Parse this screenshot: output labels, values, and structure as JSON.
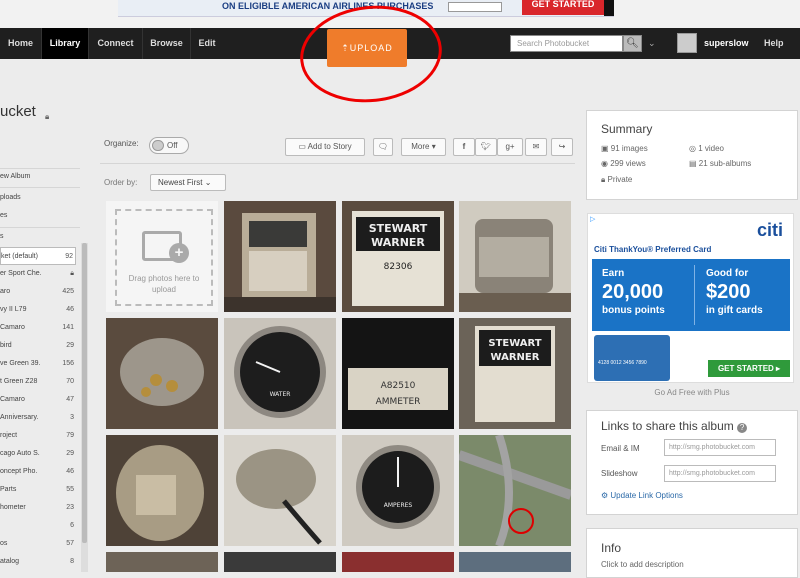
{
  "top_ad": {
    "text": "ON ELIGIBLE AMERICAN AIRLINES PURCHASES",
    "cta": "GET STARTED"
  },
  "nav": {
    "items": [
      "Home",
      "Library",
      "Connect",
      "Browse",
      "Edit"
    ],
    "active": "Library",
    "upload_label": "⇡UPLOAD",
    "search_placeholder": "Search Photobucket",
    "username": "superslow",
    "help": "Help"
  },
  "album": {
    "title_fragment": "ucket"
  },
  "sidebar": {
    "new_album": "ew Album",
    "uploads": "ploads",
    "es": "es",
    "s": "s",
    "albums": [
      {
        "label": "ket (default)",
        "count": "92"
      },
      {
        "label": "er Sport Che.",
        "count": ""
      },
      {
        "label": "aro",
        "count": "425"
      },
      {
        "label": "vy II L79",
        "count": "46"
      },
      {
        "label": "Camaro",
        "count": "141"
      },
      {
        "label": "bird",
        "count": "29"
      },
      {
        "label": "ve Green 39.",
        "count": "156"
      },
      {
        "label": "t Green Z28",
        "count": "70"
      },
      {
        "label": "Camaro",
        "count": "47"
      },
      {
        "label": " Anniversary.",
        "count": "3"
      },
      {
        "label": "roject",
        "count": "79"
      },
      {
        "label": "cago Auto S.",
        "count": "29"
      },
      {
        "label": "oncept Pho.",
        "count": "46"
      },
      {
        "label": " Parts",
        "count": "55"
      },
      {
        "label": "hometer",
        "count": "23"
      },
      {
        "label": "",
        "count": "6"
      },
      {
        "label": "os",
        "count": "57"
      },
      {
        "label": "atalog",
        "count": "8"
      }
    ]
  },
  "toolbar": {
    "organize_label": "Organize:",
    "toggle_label": "Off",
    "add_to_story": "Add to Story",
    "more": "More",
    "order_by_label": "Order by:",
    "order_value": "Newest First"
  },
  "dropzone": {
    "text": "Drag photos here to upload"
  },
  "summary": {
    "title": "Summary",
    "images": "91 images",
    "videos": "1 video",
    "views": "299 views",
    "subalbums": "21 sub-albums",
    "privacy": "Private"
  },
  "ad": {
    "brand": "citi",
    "headline": "Citi ThankYou® Preferred Card",
    "earn": "Earn",
    "earn_points": "20,000",
    "earn_sub": "bonus points",
    "good_for": "Good for",
    "good_amount": "$200",
    "good_sub": "in gift cards",
    "cta": "GET STARTED ▸",
    "card_num": "4128 0012 3456 7890",
    "ad_free": "Go Ad Free with Plus"
  },
  "share": {
    "title": "Links to share this album",
    "email_label": "Email & IM",
    "email_value": "http://smg.photobucket.com",
    "slideshow_label": "Slideshow",
    "slideshow_value": "http://smg.photobucket.com",
    "update_link": "Update Link Options"
  },
  "info": {
    "title": "Info",
    "desc": "Click to add description"
  },
  "colors": {
    "nav_bg": "#1f1f1f",
    "upload": "#ef7c2b",
    "annotation": "#e00000",
    "link": "#2c6aa8"
  }
}
